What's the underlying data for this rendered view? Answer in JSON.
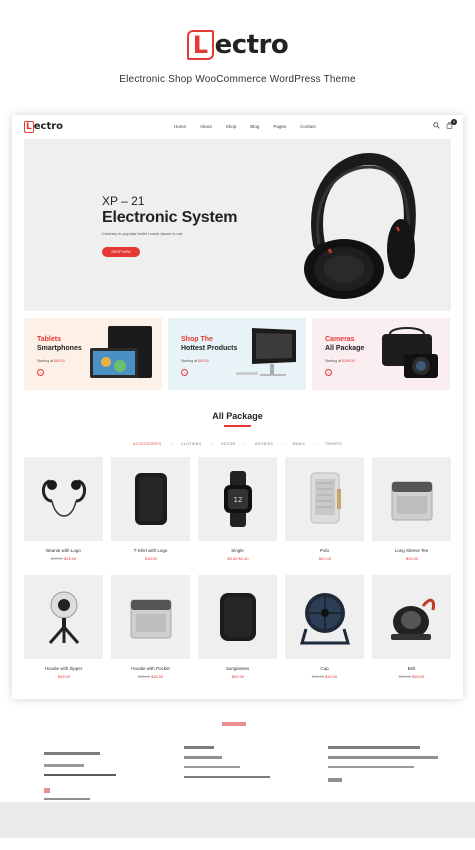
{
  "brand": {
    "logo_letter": "L",
    "logo_rest": "ectro",
    "subtitle": "Electronic Shop WooCommerce WordPress Theme",
    "accent_color": "#e53935"
  },
  "nav": {
    "logo_letter": "L",
    "logo_rest": "ectro",
    "links": [
      "Home",
      "About",
      "Shop",
      "Blog",
      "Pages",
      "Contact"
    ],
    "search_icon": "search-icon",
    "cart_icon": "cart-icon",
    "cart_count": "0"
  },
  "hero": {
    "pretitle": "XP – 21",
    "title": "Electronic System",
    "description": "Contrary to popular belief Lorem Ipsum is not",
    "button": "SHOP NOW"
  },
  "promos": [
    {
      "title_red": "Tablets",
      "title_dark": "Smartphones",
      "price_label": "Starting at",
      "price": "$99.00"
    },
    {
      "title_red": "Shop The",
      "title_dark": "Hottest Products",
      "price_label": "Starting at",
      "price": "$99.00"
    },
    {
      "title_red": "Cameras",
      "title_dark": "All Package",
      "price_label": "Starting at",
      "price": "$299.00"
    }
  ],
  "section": {
    "title": "All Package",
    "tabs": [
      "ACCESSORIES",
      "CLOTHING",
      "DECOR",
      "HOODIES",
      "MUSIC",
      "TSHIRTS"
    ]
  },
  "products": [
    {
      "name": "Beanie with Logo",
      "old_price": "$20.00",
      "price": "$18.00",
      "icon": "earbuds"
    },
    {
      "name": "T-Shirt with Logo",
      "old_price": "",
      "price": "$18.00",
      "icon": "speaker"
    },
    {
      "name": "Single",
      "old_price": "",
      "price": "$3.00 $2.00",
      "icon": "watch"
    },
    {
      "name": "Polo",
      "old_price": "",
      "price": "$20.00",
      "icon": "heater"
    },
    {
      "name": "Long Sleeve Tee",
      "old_price": "",
      "price": "$25.00",
      "icon": "icemaker"
    },
    {
      "name": "Hoodie with Zipper",
      "old_price": "",
      "price": "$45.00",
      "icon": "camera360"
    },
    {
      "name": "Hoodie with Pocket",
      "old_price": "$45.00",
      "price": "$35.00",
      "icon": "icemaker"
    },
    {
      "name": "Sunglasses",
      "old_price": "",
      "price": "$90.00",
      "icon": "speaker"
    },
    {
      "name": "Cap",
      "old_price": "$18.00",
      "price": "$16.00",
      "icon": "fan"
    },
    {
      "name": "Belt",
      "old_price": "$65.00",
      "price": "$55.00",
      "icon": "vacuum"
    }
  ]
}
